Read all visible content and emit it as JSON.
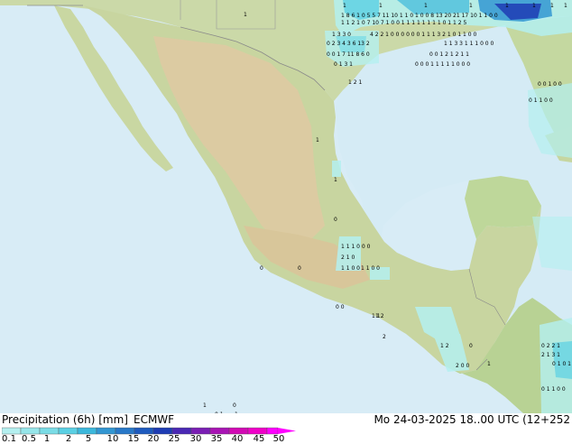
{
  "product": {
    "title": "Precipitation (6h) [mm]",
    "model": "ECMWF",
    "valid_time": "Mo 24-03-2025 18..00 UTC (12+252"
  },
  "legend": {
    "ticks": [
      "0.1",
      "0.5",
      "1",
      "2",
      "5",
      "10",
      "15",
      "20",
      "25",
      "30",
      "35",
      "40",
      "45",
      "50"
    ],
    "colors": [
      "#b4f0f0",
      "#96e6ea",
      "#7adce6",
      "#5ad0e4",
      "#3cb8dc",
      "#3296d2",
      "#2878c8",
      "#1e5abe",
      "#1e3cb4",
      "#4a28b4",
      "#7a1eb4",
      "#a814b4",
      "#d20ab4",
      "#f000c8",
      "#ff00ff"
    ]
  },
  "map_numbers": [
    [
      "1",
      "1",
      "1",
      "1",
      "1",
      "1",
      "1",
      "1",
      "1"
    ],
    [
      "1 8 6 1 0 5 5 7 11 10 1 1 0 1 0 0 8 13 20 21 17 10 1 1 0 0"
    ],
    [
      "1 1 2 1 0 7 10 7 1 0 0 1 1 1 1 1 1 1 1 0 1 1 2 5"
    ],
    [
      "1 3 3 0",
      "4 2 2 1 0 0 0 0 0 0 1 1 1 3 2 1 0 1 1 0 0"
    ],
    [
      "0 2 3 4 3 6 13 2",
      "1 1 3 3 1 1 1 0 0 0"
    ],
    [
      "0 0 1 7 11 8 6 0",
      "0 0 1 2 1 2 1 1"
    ],
    [
      "0 1 3 1",
      "0 0 0 1 1 1 1 1 0 0 0"
    ],
    [
      "1 2 1",
      "0 0 1 0 0",
      "0 1 1 0 0"
    ],
    [
      "1",
      "1",
      "0",
      "1 1 0 0",
      "2 1 0",
      "1 1 1 0 0 0",
      "1 1 0 0"
    ],
    [
      "0",
      "0",
      "1 1",
      "0 0",
      "1 2",
      "2",
      "0",
      "1",
      "1 2",
      "2 0 0"
    ],
    [
      "0 2 2 1",
      "2 1 3 1",
      "0 1 0 1",
      "0 1 1 0 0"
    ],
    [
      "1",
      "0",
      "0 1",
      "1"
    ]
  ]
}
